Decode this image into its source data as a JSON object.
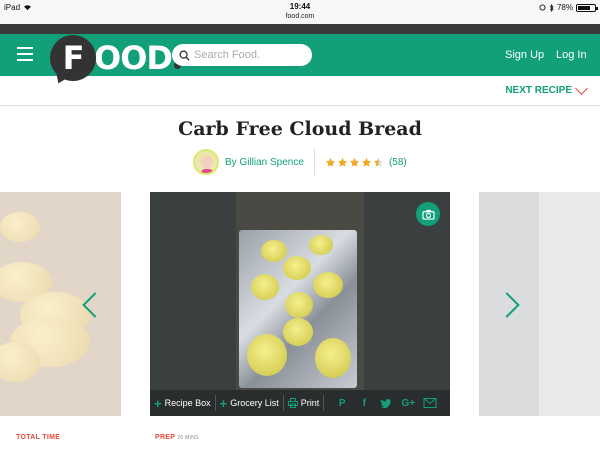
{
  "status_bar": {
    "device": "iPad",
    "time": "19:44",
    "url": "food.com",
    "battery": "78%",
    "battery_level": 0.78
  },
  "header": {
    "logo_first_letter": "F",
    "logo_rest": "OOD",
    "search_placeholder": "Search Food.",
    "signup_label": "Sign Up",
    "login_label": "Log In",
    "brand_color": "#11a07a"
  },
  "subnav": {
    "next_recipe_label": "NEXT RECIPE"
  },
  "recipe": {
    "title": "Carb Free Cloud Bread",
    "author": "By Gillian Spence",
    "rating": 4.5,
    "rating_count": "(58)"
  },
  "actions": {
    "recipe_box": "Recipe Box",
    "grocery_list": "Grocery List",
    "print": "Print",
    "share_icons": [
      "pinterest-icon",
      "facebook-icon",
      "twitter-icon",
      "google-plus-icon",
      "email-icon"
    ]
  },
  "info": {
    "total_time_label": "TOTAL TIME",
    "prep_label": "PREP",
    "prep_value": "20 MINS"
  }
}
